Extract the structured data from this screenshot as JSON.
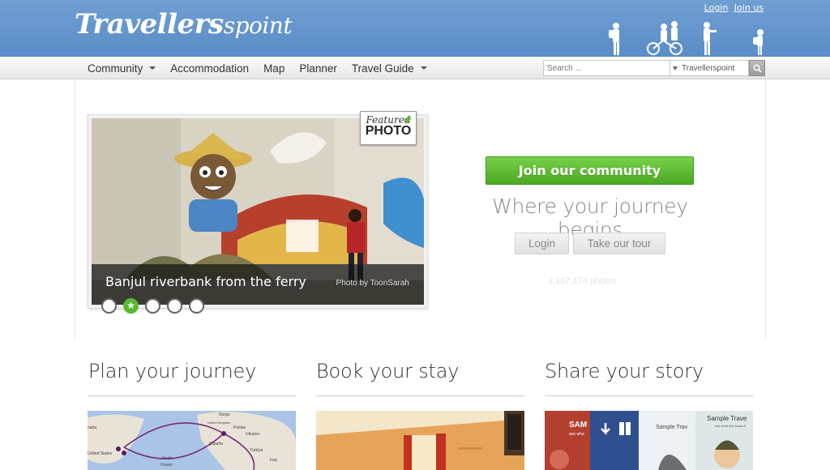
{
  "header": {
    "logo_part1": "Travellers",
    "logo_part2": "point",
    "login_link": "Login",
    "join_link": "Join us"
  },
  "nav": {
    "items": [
      {
        "label": "Community",
        "dropdown": true
      },
      {
        "label": "Accommodation",
        "dropdown": false
      },
      {
        "label": "Map",
        "dropdown": false
      },
      {
        "label": "Planner",
        "dropdown": false
      },
      {
        "label": "Travel Guide",
        "dropdown": true
      }
    ]
  },
  "search": {
    "placeholder": "Search ...",
    "scope": "Travellerspoint"
  },
  "featured": {
    "badge_line1": "Featured",
    "badge_line2": "PHOTO",
    "caption": "Banjul riverbank from the ferry",
    "credit": "Photo by ToonSarah",
    "active_dot": 2
  },
  "hero": {
    "join_button": "Join our community",
    "tagline": "Where your journey begins",
    "login_button": "Login",
    "tour_button": "Take our tour",
    "photos_count": "3,167,174 photos"
  },
  "sections": [
    {
      "title": "Plan your journey"
    },
    {
      "title": "Book your stay"
    },
    {
      "title": "Share your story"
    }
  ],
  "thumb_texts": {
    "map_labels": [
      "nada",
      "Norge",
      "United Kingdom",
      "Polska",
      "Ukraine",
      "United States",
      "Ocean",
      "North",
      "España",
      "Türkiye",
      "Iraq"
    ],
    "story_sample1": "SAM",
    "story_sample1b": "see wha",
    "story_sample2": "Sample Trav",
    "story_sample3": "Sample Trave",
    "story_sample3b": "see what this books fi"
  },
  "colors": {
    "header_blue": "#5a8cc6",
    "join_green": "#4aa823",
    "accent_star": "#5cb832"
  }
}
